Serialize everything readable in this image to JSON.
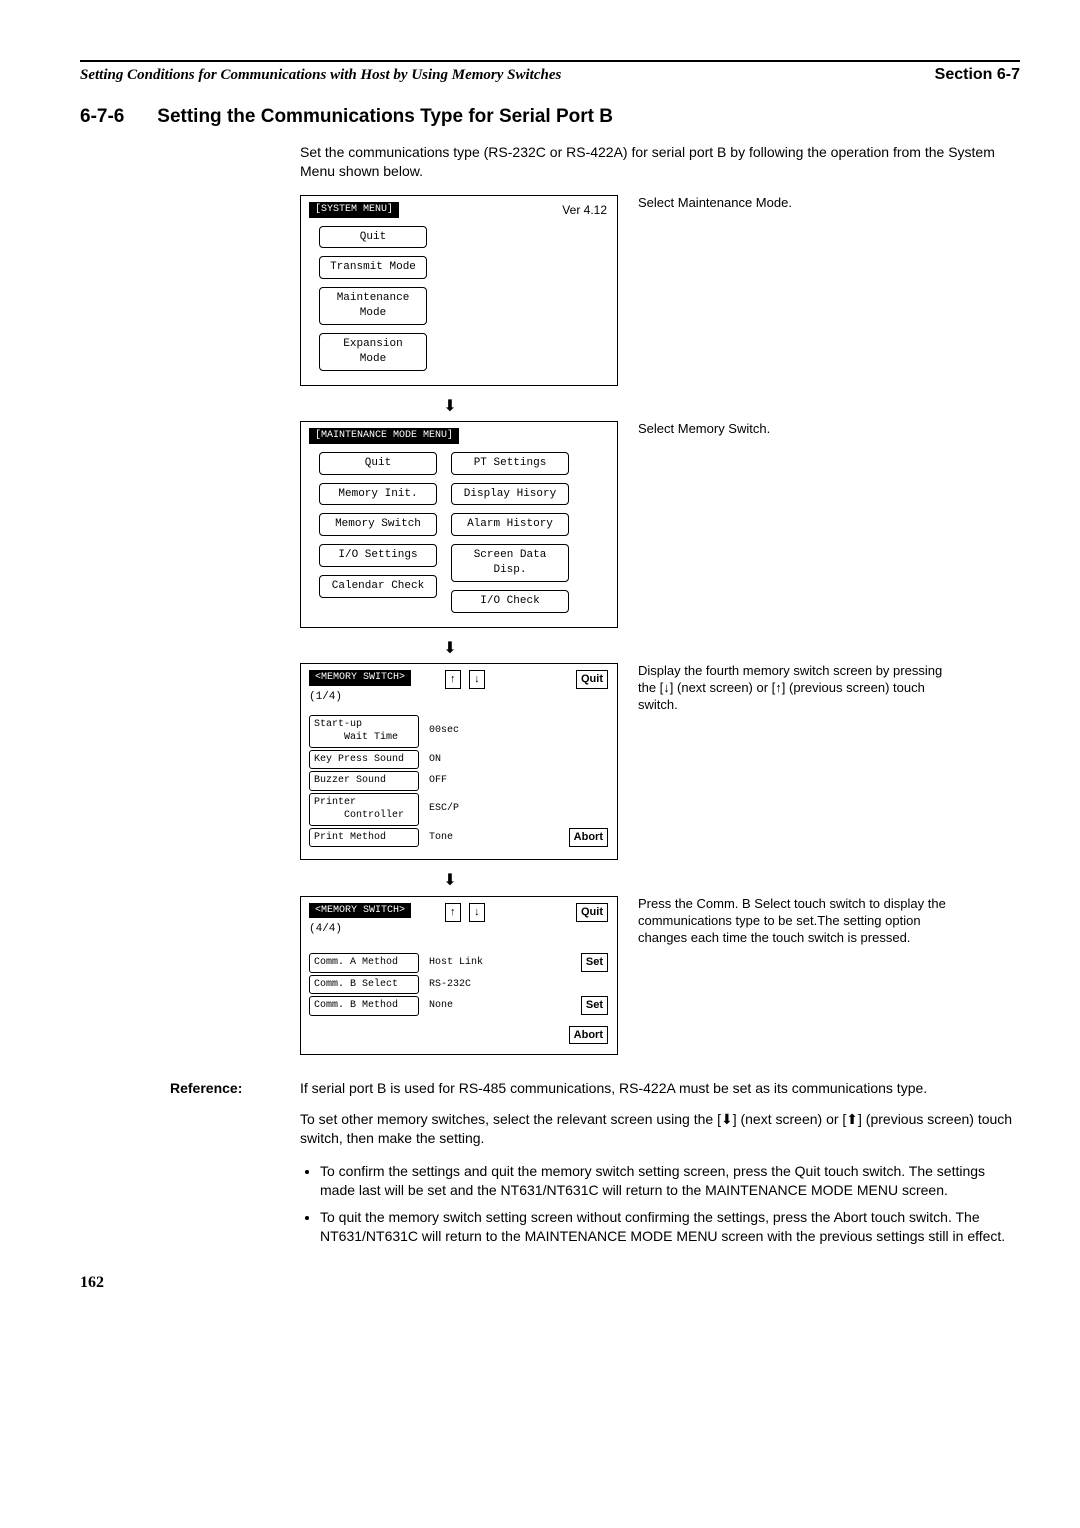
{
  "header": {
    "left": "Setting Conditions for Communications with Host by Using Memory Switches",
    "right": "Section 6-7"
  },
  "section": {
    "number": "6-7-6",
    "title": "Setting the Communications Type for Serial Port B"
  },
  "intro": "Set the communications type (RS-232C or RS-422A) for serial port B by following the operation from the System Menu shown below.",
  "screen1": {
    "title": "[SYSTEM MENU]",
    "version": "Ver 4.12",
    "items": [
      "Quit",
      "Transmit Mode",
      "Maintenance Mode",
      "Expansion Mode"
    ],
    "caption": "Select Maintenance Mode."
  },
  "screen2": {
    "title": "[MAINTENANCE MODE MENU]",
    "left": [
      "Quit",
      "Memory Init.",
      "Memory Switch",
      "I/O Settings",
      "Calendar Check"
    ],
    "right": [
      "PT Settings",
      "Display Hisory",
      "Alarm History",
      "Screen Data Disp.",
      "I/O Check"
    ],
    "caption": "Select Memory Switch."
  },
  "screen3": {
    "title": "<MEMORY SWITCH>",
    "page": "(1/4)",
    "up": "↑",
    "down": "↓",
    "quit": "Quit",
    "abort": "Abort",
    "rows": [
      {
        "label": "Start-up\n     Wait Time",
        "val": "00sec"
      },
      {
        "label": "Key Press Sound",
        "val": "ON"
      },
      {
        "label": "Buzzer Sound",
        "val": "OFF"
      },
      {
        "label": "Printer\n     Controller",
        "val": "ESC/P"
      },
      {
        "label": "Print Method",
        "val": "Tone"
      }
    ],
    "caption": "Display the fourth memory switch screen by pressing the [↓] (next screen) or [↑] (previous screen) touch switch."
  },
  "screen4": {
    "title": "<MEMORY SWITCH>",
    "page": "(4/4)",
    "up": "↑",
    "down": "↓",
    "quit": "Quit",
    "set": "Set",
    "abort": "Abort",
    "rows": [
      {
        "label": "Comm. A Method",
        "val": "Host Link",
        "btn": "Set"
      },
      {
        "label": "Comm. B Select",
        "val": "RS-232C"
      },
      {
        "label": "Comm. B Method",
        "val": "None",
        "btn": "Set"
      }
    ],
    "caption": "Press the Comm. B Select touch switch to display the communications type to be set.The setting option changes each time the touch switch is pressed."
  },
  "reference": {
    "label": "Reference:",
    "text": "If serial port B is used for RS-485 communications, RS-422A must be set as its communications type."
  },
  "para1": "To set other memory switches, select the relevant screen using the [⬇] (next screen) or [⬆] (previous screen) touch switch, then make the setting.",
  "bullet1": "To confirm the settings and quit the memory switch setting screen, press the Quit touch switch. The settings made last will be set and the NT631/NT631C will return to the MAINTENANCE MODE MENU screen.",
  "bullet2": "To quit the memory switch setting screen without confirming the settings, press the Abort touch switch. The NT631/NT631C will return to the MAINTENANCE MODE MENU screen with the previous settings still in effect.",
  "pagenum": "162",
  "arrow": "⬇"
}
